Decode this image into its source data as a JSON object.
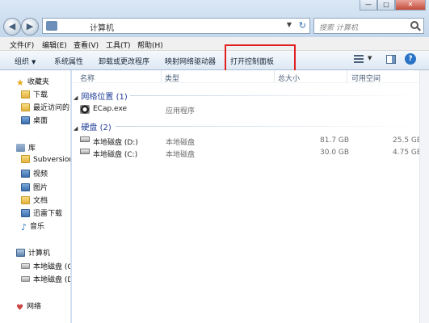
{
  "window": {
    "address_text": "计算机",
    "search_placeholder": "搜索 计算机",
    "minimize_label": "—",
    "maximize_label": "□",
    "close_label": "✕"
  },
  "menu": [
    "文件(F)",
    "编辑(E)",
    "查看(V)",
    "工具(T)",
    "帮助(H)"
  ],
  "toolbar": {
    "organize": "组织",
    "items": [
      "系统属性",
      "卸载或更改程序",
      "映射网络驱动器",
      "打开控制面板"
    ]
  },
  "nav": {
    "favorites": "收藏夹",
    "favorite_items": [
      "下载",
      "最近访问的",
      "桌面"
    ],
    "libraries": "库",
    "library_items": [
      "Subversion",
      "视频",
      "图片",
      "文档",
      "迅雷下载",
      "音乐"
    ],
    "computer": "计算机",
    "computer_items": [
      "本地磁盘 (C",
      "本地磁盘 (D"
    ],
    "network": "网络"
  },
  "columns": {
    "name": "名称",
    "type": "类型",
    "total": "总大小",
    "free": "可用空间"
  },
  "groups": {
    "network_location": "网络位置 (1)",
    "hard_disks": "硬盘 (2)"
  },
  "network_items": [
    {
      "name": "ECap.exe",
      "type": "应用程序"
    }
  ],
  "disks": [
    {
      "name": "本地磁盘 (D:)",
      "type": "本地磁盘",
      "total": "81.7 GB",
      "free": "25.5 GB"
    },
    {
      "name": "本地磁盘 (C:)",
      "type": "本地磁盘",
      "total": "30.0 GB",
      "free": "4.75 GB"
    }
  ]
}
